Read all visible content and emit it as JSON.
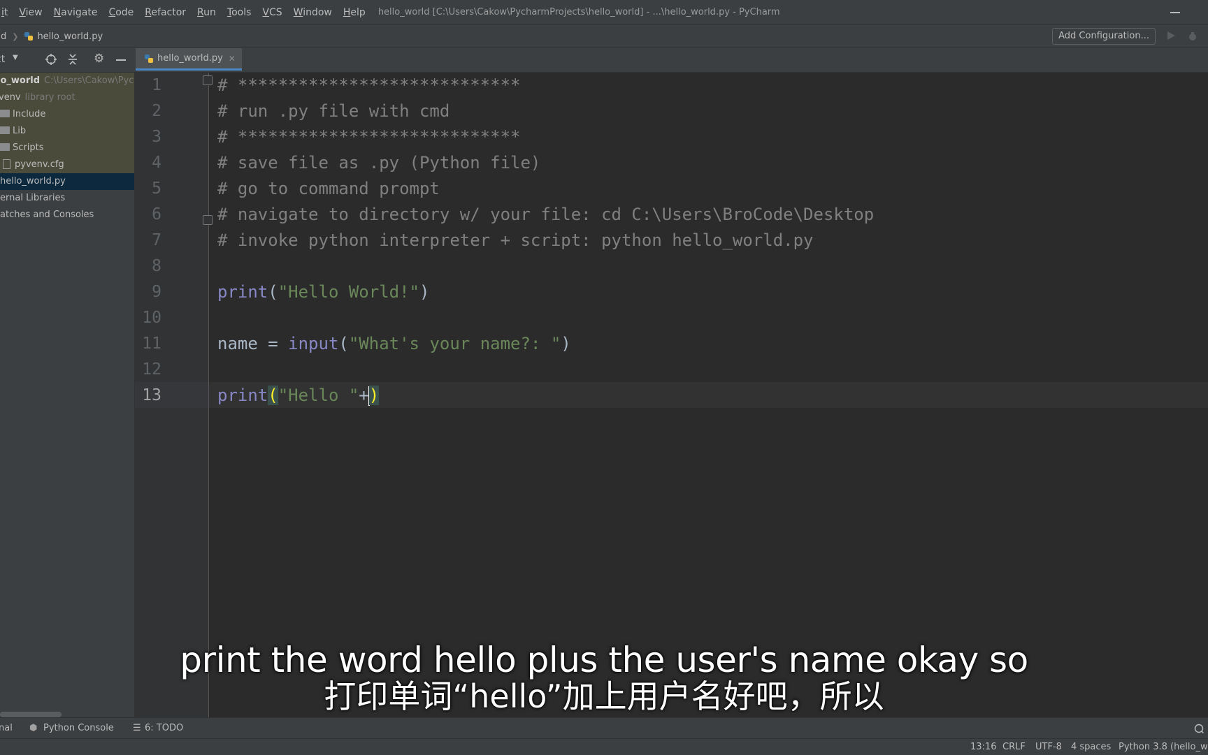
{
  "menu": {
    "items": [
      "it",
      "View",
      "Navigate",
      "Code",
      "Refactor",
      "Run",
      "Tools",
      "VCS",
      "Window",
      "Help"
    ],
    "title": "hello_world [C:\\Users\\Cakow\\PycharmProjects\\hello_world] - ...\\hello_world.py - PyCharm"
  },
  "navbar": {
    "root": "rld",
    "file": "hello_world.py",
    "add_config": "Add Configuration..."
  },
  "project_panel": {
    "title": "ct",
    "items": [
      {
        "label": "lo_world",
        "extra": "C:\\Users\\Cakow\\Pyc"
      },
      {
        "label": "venv",
        "extra": "library root"
      },
      {
        "label": "Include"
      },
      {
        "label": "Lib"
      },
      {
        "label": "Scripts"
      },
      {
        "label": "pyvenv.cfg"
      },
      {
        "label": "hello_world.py"
      },
      {
        "label": "ernal Libraries"
      },
      {
        "label": "atches and Consoles"
      }
    ]
  },
  "tab": {
    "label": "hello_world.py"
  },
  "editor": {
    "line_numbers": [
      "1",
      "2",
      "3",
      "4",
      "5",
      "6",
      "7",
      "8",
      "9",
      "10",
      "11",
      "12",
      "13"
    ],
    "comments": [
      "# ****************************",
      "# run .py file with cmd",
      "# ****************************",
      "# save file as .py (Python file)",
      "# go to command prompt",
      "# navigate to directory w/ your file: cd C:\\Users\\BroCode\\Desktop",
      "# invoke python interpreter + script: python hello_world.py"
    ],
    "line9": {
      "fn": "print",
      "open": "(",
      "str": "\"Hello World!\"",
      "close": ")"
    },
    "line11": {
      "var": "name = ",
      "fn": "input",
      "open": "(",
      "str": "\"What's your name?: \"",
      "close": ")"
    },
    "line13": {
      "fn": "print",
      "open": "(",
      "str": "\"Hello \"",
      "op": "+",
      "close": ")"
    }
  },
  "subtitles": {
    "en": "print the word hello plus the user's name okay so",
    "zh": "打印单词“hello”加上用户名好吧，所以"
  },
  "bottom_tools": {
    "terminal": "nal",
    "python_console": "Python Console",
    "todo": "6: TODO"
  },
  "status": {
    "position": "13:16",
    "line_sep": "CRLF",
    "encoding": "UTF-8",
    "indent": "4 spaces",
    "interpreter": "Python 3.8 (hello_w"
  }
}
